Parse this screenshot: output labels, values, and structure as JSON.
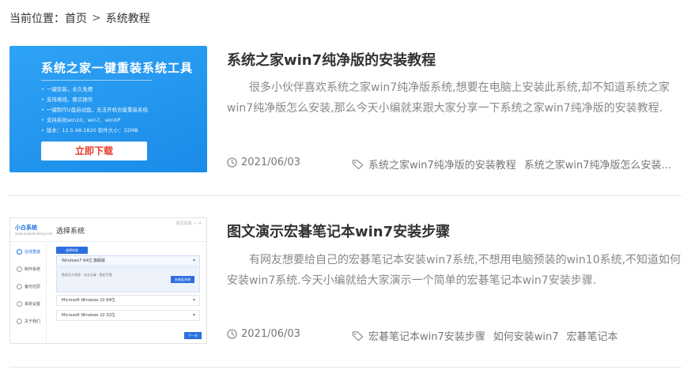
{
  "breadcrumb": {
    "prefix": "当前位置：",
    "home": "首页",
    "separator": ">",
    "current": "系统教程"
  },
  "articles": [
    {
      "title": "系统之家win7纯净版的安装教程",
      "summary": "很多小伙伴喜欢系统之家win7纯净版系统,想要在电脑上安装此系统,却不知道系统之家win7纯净版怎么安装,那么今天小编就来跟大家分享一下系统之家win7纯净版的安装教程.",
      "date": "2021/06/03",
      "tags": [
        "系统之家win7纯净版的安装教程",
        "系统之家win7纯净版怎么安装..."
      ],
      "thumbnail": {
        "heading": "系统之家一键重装系统工具",
        "features": [
          "一键安装，永久免费",
          "支持离线，傻瓜操作",
          "一键制作U盘启动盘，无法开机也能重装系统",
          "支持系统win10、win7、winXP",
          "版本：12.5.48.1820  软件大小：32MB"
        ],
        "button": "立即下载",
        "bg_color": "#1f95ec",
        "button_text_color": "#e53b2c"
      }
    },
    {
      "title": "图文演示宏碁笔记本win7安装步骤",
      "summary": "有网友想要给自己的宏碁笔记本安装win7系统,不想用电脑预装的win10系统,不知道如何安装win7系统.今天小编就给大家演示一个简单的宏碁笔记本win7安装步骤.",
      "date": "2021/06/03",
      "tags": [
        "宏碁笔记本win7安装步骤",
        "如何安装win7",
        "宏碁笔记本"
      ],
      "thumbnail": {
        "logo": "小白系统",
        "logo_sub": "www.xiaobaixitong.com",
        "window_title": "选择系统",
        "window_controls": "意见反馈  —  ✕",
        "tab": "选择系统",
        "sidebar": [
          "在线重装",
          "制作系统",
          "备份还原",
          "系统设置",
          "关于我们"
        ],
        "os_rows": [
          "Windows7 64位 旗舰版",
          "Microsoft Windows 10 64位",
          "Microsoft Windows 10 32位"
        ],
        "panel_text": "微软官方原版 · 安全无毒 · 稳定可靠",
        "panel_button": "安装此系统",
        "next_button": "下一步",
        "accent_color": "#2b6fe0"
      }
    }
  ]
}
